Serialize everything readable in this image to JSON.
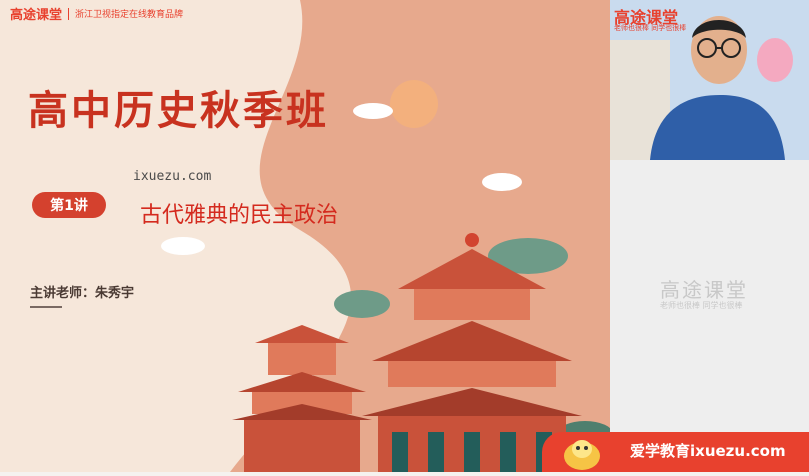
{
  "brand": {
    "logo": "高途课堂",
    "tagline": "浙江卫视指定在线教育品牌"
  },
  "slide": {
    "title": "高中历史秋季班",
    "watermark": "ixuezu.com",
    "lecture_badge": "第1讲",
    "lecture_title": "古代雅典的民主政治",
    "teacher": "主讲老师：朱秀宇"
  },
  "video": {
    "logo": "高途课堂",
    "sub": "老师也很棒  同学也很棒"
  },
  "placeholder": {
    "logo": "高途课堂",
    "sub": "老师也很棒  同学也很棒"
  },
  "banner": {
    "text": "爱学教育ixuezu.com"
  },
  "colors": {
    "brand_red": "#e8412e",
    "slide_bg": "#f6e7da",
    "building": "#c9523a"
  }
}
